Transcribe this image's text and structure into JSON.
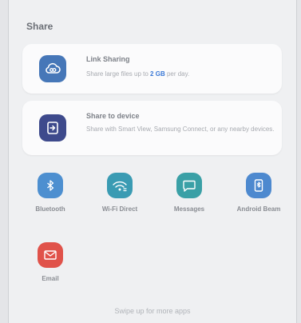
{
  "sheet": {
    "title": "Share"
  },
  "cards": {
    "link_sharing": {
      "title": "Link Sharing",
      "desc_prefix": "Share large files up to ",
      "desc_highlight": "2 GB",
      "desc_suffix": " per day.",
      "icon": "cloud-link-icon",
      "color": "#4677b8"
    },
    "share_to_device": {
      "title": "Share to device",
      "desc": "Share with Smart View, Samsung Connect, or any nearby devices.",
      "icon": "screen-share-icon",
      "color": "#3e4a8c"
    }
  },
  "apps": [
    {
      "label": "Bluetooth",
      "icon": "bluetooth-icon",
      "color": "#4d8fd0"
    },
    {
      "label": "Wi-Fi Direct",
      "icon": "wifi-direct-icon",
      "color": "#3a9bb3"
    },
    {
      "label": "Messages",
      "icon": "message-icon",
      "color": "#3aa0a6"
    },
    {
      "label": "Android Beam",
      "icon": "android-beam-icon",
      "color": "#4d89cf"
    },
    {
      "label": "Email",
      "icon": "email-icon",
      "color": "#e0524a"
    }
  ],
  "footer": {
    "hint": "Swipe up for more apps"
  }
}
